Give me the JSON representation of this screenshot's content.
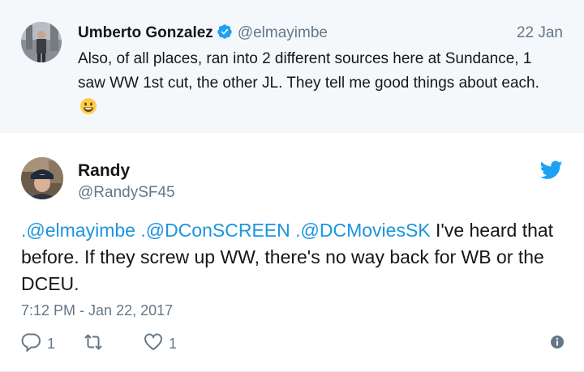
{
  "parent_tweet": {
    "author_name": "Umberto Gonzalez",
    "author_handle": "@elmayimbe",
    "date": "22 Jan",
    "text": "Also, of all places, ran into 2 different sources here at Sundance, 1 saw WW 1st cut, the other JL. They tell me good things about each.",
    "emoji": "smiley-emoji",
    "verified": true
  },
  "tweet": {
    "author_name": "Randy",
    "author_handle": "@RandySF45",
    "mentions": [
      ".@elmayimbe",
      ".@DConSCREEN",
      ".@DCMoviesSK"
    ],
    "text_rest": "I've heard that before. If they screw up WW, there's no way back for WB or the DCEU.",
    "timestamp": "7:12 PM - Jan 22, 2017",
    "reply_count": "1",
    "like_count": "1"
  },
  "icons": {
    "verified": "verified-badge-icon",
    "brand": "twitter-bird-icon",
    "reply": "reply-icon",
    "retweet": "retweet-icon",
    "like": "heart-icon",
    "info": "info-icon"
  },
  "colors": {
    "accent": "#1b95e0",
    "muted": "#657786",
    "parent_bg": "#f5f8fa"
  }
}
